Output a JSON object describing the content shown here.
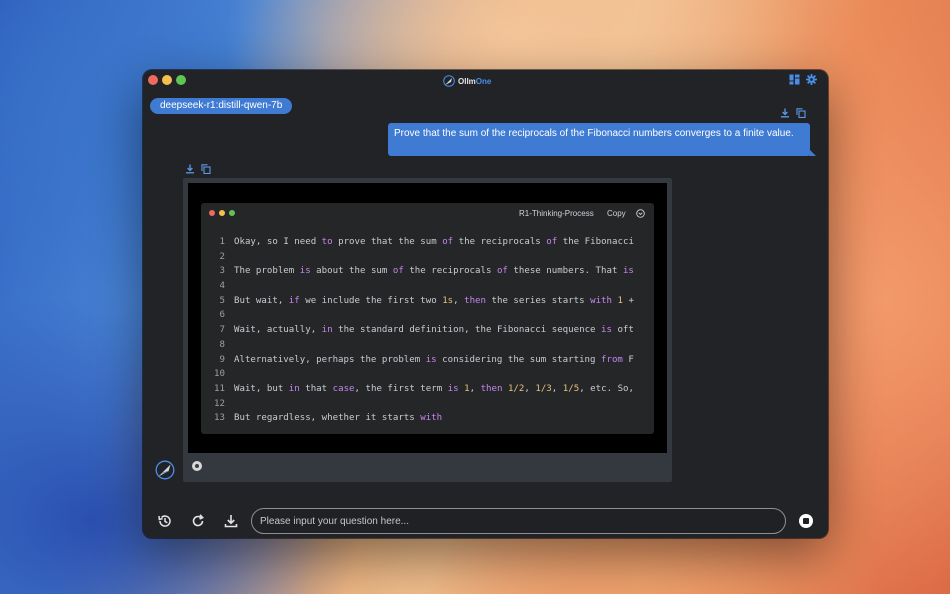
{
  "window": {
    "app_name_part1": "Ollm",
    "app_name_part2": "One",
    "icons": [
      "layout-icon",
      "gear-icon"
    ]
  },
  "model_chip": "deepseek-r1:distill-qwen-7b",
  "user_message": "Prove that the sum of the reciprocals of the Fibonacci numbers converges to a finite value.",
  "code_block": {
    "title": "R1-Thinking-Process",
    "copy_label": "Copy",
    "lines": [
      {
        "n": "1",
        "t": "Okay, so I need to prove that the sum of the reciprocals of the Fibonacci"
      },
      {
        "n": "2",
        "t": ""
      },
      {
        "n": "3",
        "t": "The problem is about the sum of the reciprocals of these numbers. That is"
      },
      {
        "n": "4",
        "t": ""
      },
      {
        "n": "5",
        "t": "But wait, if we include the first two 1s, then the series starts with 1 +"
      },
      {
        "n": "6",
        "t": ""
      },
      {
        "n": "7",
        "t": "Wait, actually, in the standard definition, the Fibonacci sequence is oft"
      },
      {
        "n": "8",
        "t": ""
      },
      {
        "n": "9",
        "t": "Alternatively, perhaps the problem is considering the sum starting from F"
      },
      {
        "n": "10",
        "t": ""
      },
      {
        "n": "11",
        "t": "Wait, but in that case, the first term is 1, then 1/2, 1/3, 1/5, etc. So,"
      },
      {
        "n": "12",
        "t": ""
      },
      {
        "n": "13",
        "t": "But regardless, whether it starts with"
      }
    ]
  },
  "input": {
    "placeholder": "Please input your question here...",
    "value": ""
  },
  "colors": {
    "accent": "#3f7bd2",
    "keyword": "#c586f0",
    "number": "#e6c07b"
  }
}
